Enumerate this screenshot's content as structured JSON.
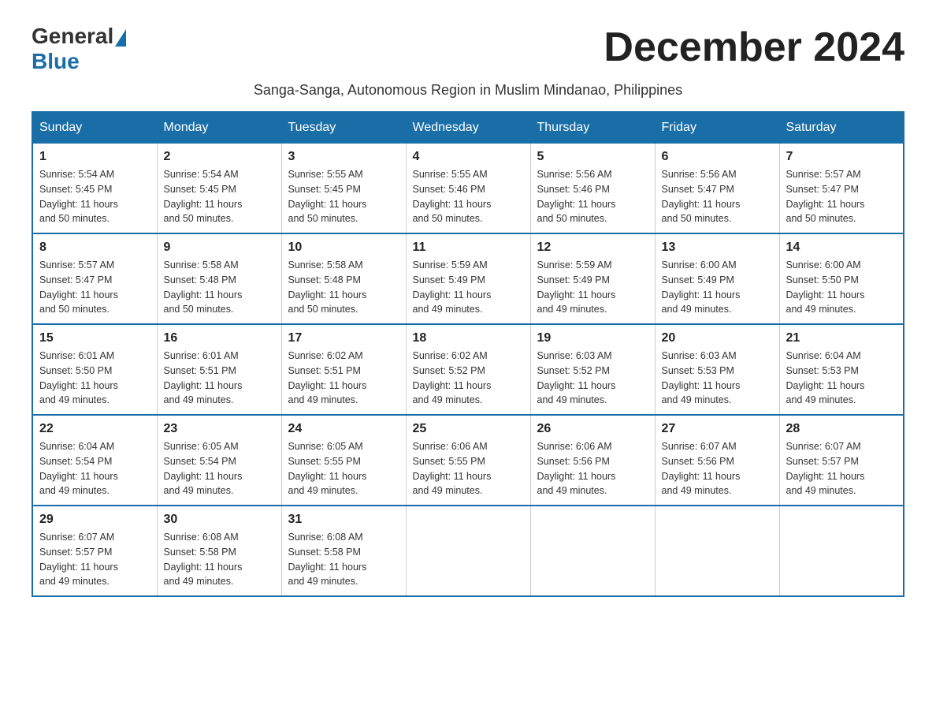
{
  "logo": {
    "general": "General",
    "blue": "Blue"
  },
  "title": "December 2024",
  "subtitle": "Sanga-Sanga, Autonomous Region in Muslim Mindanao, Philippines",
  "weekdays": [
    "Sunday",
    "Monday",
    "Tuesday",
    "Wednesday",
    "Thursday",
    "Friday",
    "Saturday"
  ],
  "weeks": [
    [
      {
        "day": "1",
        "sunrise": "5:54 AM",
        "sunset": "5:45 PM",
        "daylight": "11 hours and 50 minutes."
      },
      {
        "day": "2",
        "sunrise": "5:54 AM",
        "sunset": "5:45 PM",
        "daylight": "11 hours and 50 minutes."
      },
      {
        "day": "3",
        "sunrise": "5:55 AM",
        "sunset": "5:45 PM",
        "daylight": "11 hours and 50 minutes."
      },
      {
        "day": "4",
        "sunrise": "5:55 AM",
        "sunset": "5:46 PM",
        "daylight": "11 hours and 50 minutes."
      },
      {
        "day": "5",
        "sunrise": "5:56 AM",
        "sunset": "5:46 PM",
        "daylight": "11 hours and 50 minutes."
      },
      {
        "day": "6",
        "sunrise": "5:56 AM",
        "sunset": "5:47 PM",
        "daylight": "11 hours and 50 minutes."
      },
      {
        "day": "7",
        "sunrise": "5:57 AM",
        "sunset": "5:47 PM",
        "daylight": "11 hours and 50 minutes."
      }
    ],
    [
      {
        "day": "8",
        "sunrise": "5:57 AM",
        "sunset": "5:47 PM",
        "daylight": "11 hours and 50 minutes."
      },
      {
        "day": "9",
        "sunrise": "5:58 AM",
        "sunset": "5:48 PM",
        "daylight": "11 hours and 50 minutes."
      },
      {
        "day": "10",
        "sunrise": "5:58 AM",
        "sunset": "5:48 PM",
        "daylight": "11 hours and 50 minutes."
      },
      {
        "day": "11",
        "sunrise": "5:59 AM",
        "sunset": "5:49 PM",
        "daylight": "11 hours and 49 minutes."
      },
      {
        "day": "12",
        "sunrise": "5:59 AM",
        "sunset": "5:49 PM",
        "daylight": "11 hours and 49 minutes."
      },
      {
        "day": "13",
        "sunrise": "6:00 AM",
        "sunset": "5:49 PM",
        "daylight": "11 hours and 49 minutes."
      },
      {
        "day": "14",
        "sunrise": "6:00 AM",
        "sunset": "5:50 PM",
        "daylight": "11 hours and 49 minutes."
      }
    ],
    [
      {
        "day": "15",
        "sunrise": "6:01 AM",
        "sunset": "5:50 PM",
        "daylight": "11 hours and 49 minutes."
      },
      {
        "day": "16",
        "sunrise": "6:01 AM",
        "sunset": "5:51 PM",
        "daylight": "11 hours and 49 minutes."
      },
      {
        "day": "17",
        "sunrise": "6:02 AM",
        "sunset": "5:51 PM",
        "daylight": "11 hours and 49 minutes."
      },
      {
        "day": "18",
        "sunrise": "6:02 AM",
        "sunset": "5:52 PM",
        "daylight": "11 hours and 49 minutes."
      },
      {
        "day": "19",
        "sunrise": "6:03 AM",
        "sunset": "5:52 PM",
        "daylight": "11 hours and 49 minutes."
      },
      {
        "day": "20",
        "sunrise": "6:03 AM",
        "sunset": "5:53 PM",
        "daylight": "11 hours and 49 minutes."
      },
      {
        "day": "21",
        "sunrise": "6:04 AM",
        "sunset": "5:53 PM",
        "daylight": "11 hours and 49 minutes."
      }
    ],
    [
      {
        "day": "22",
        "sunrise": "6:04 AM",
        "sunset": "5:54 PM",
        "daylight": "11 hours and 49 minutes."
      },
      {
        "day": "23",
        "sunrise": "6:05 AM",
        "sunset": "5:54 PM",
        "daylight": "11 hours and 49 minutes."
      },
      {
        "day": "24",
        "sunrise": "6:05 AM",
        "sunset": "5:55 PM",
        "daylight": "11 hours and 49 minutes."
      },
      {
        "day": "25",
        "sunrise": "6:06 AM",
        "sunset": "5:55 PM",
        "daylight": "11 hours and 49 minutes."
      },
      {
        "day": "26",
        "sunrise": "6:06 AM",
        "sunset": "5:56 PM",
        "daylight": "11 hours and 49 minutes."
      },
      {
        "day": "27",
        "sunrise": "6:07 AM",
        "sunset": "5:56 PM",
        "daylight": "11 hours and 49 minutes."
      },
      {
        "day": "28",
        "sunrise": "6:07 AM",
        "sunset": "5:57 PM",
        "daylight": "11 hours and 49 minutes."
      }
    ],
    [
      {
        "day": "29",
        "sunrise": "6:07 AM",
        "sunset": "5:57 PM",
        "daylight": "11 hours and 49 minutes."
      },
      {
        "day": "30",
        "sunrise": "6:08 AM",
        "sunset": "5:58 PM",
        "daylight": "11 hours and 49 minutes."
      },
      {
        "day": "31",
        "sunrise": "6:08 AM",
        "sunset": "5:58 PM",
        "daylight": "11 hours and 49 minutes."
      },
      null,
      null,
      null,
      null
    ]
  ]
}
